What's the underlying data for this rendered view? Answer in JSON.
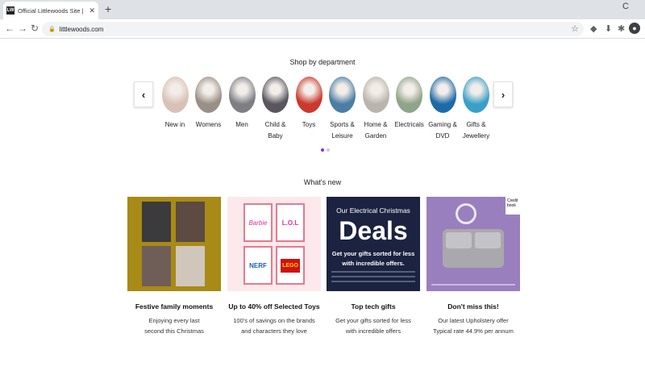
{
  "browser": {
    "tab_title": "Official Littlewoods Site | Online",
    "favicon_text": "LW",
    "url": "littlewoods.com"
  },
  "departments": {
    "heading": "Shop by department",
    "items": [
      {
        "label_1": "New in",
        "label_2": "",
        "color": "#d8c2b6"
      },
      {
        "label_1": "Womens",
        "label_2": "",
        "color": "#9a8f86"
      },
      {
        "label_1": "Men",
        "label_2": "",
        "color": "#7d7f85"
      },
      {
        "label_1": "Child &",
        "label_2": "Baby",
        "color": "#5a5660"
      },
      {
        "label_1": "Toys",
        "label_2": "",
        "color": "#c93a2d"
      },
      {
        "label_1": "Sports &",
        "label_2": "Leisure",
        "color": "#4b7ea3"
      },
      {
        "label_1": "Home &",
        "label_2": "Garden",
        "color": "#b9b5ad"
      },
      {
        "label_1": "Electricals",
        "label_2": "",
        "color": "#8fa48a"
      },
      {
        "label_1": "Gaming &",
        "label_2": "DVD",
        "color": "#1e6aa8"
      },
      {
        "label_1": "Gifts &",
        "label_2": "Jewellery",
        "color": "#3aa0c8"
      }
    ]
  },
  "whats_new": {
    "heading": "What's new",
    "cards": [
      {
        "title": "Festive family moments",
        "desc_1": "Enjoying every last",
        "desc_2": "second this Christmas"
      },
      {
        "title": "Up to 40% off Selected Toys",
        "desc_1": "100's of savings on the brands",
        "desc_2": "and characters they love"
      },
      {
        "title": "Top tech gifts",
        "desc_1": "Get your gifts sorted for less",
        "desc_2": "with incredible offers"
      },
      {
        "title": "Don't miss this!",
        "desc_1": "Our latest Upholstery offer",
        "desc_2": "Typical rate 44.9% per annum"
      }
    ],
    "toys": {
      "barbie": "Barbie",
      "lol": "L.O.L",
      "nerf": "NERF",
      "lego": "LEGO"
    },
    "tech": {
      "line1": "Our Electrical Christmas",
      "line2": "Deals",
      "line3": "Get your gifts sorted for less",
      "line4": "with incredible offers."
    },
    "upholstery": {
      "badge": "Credit\nbook"
    }
  }
}
